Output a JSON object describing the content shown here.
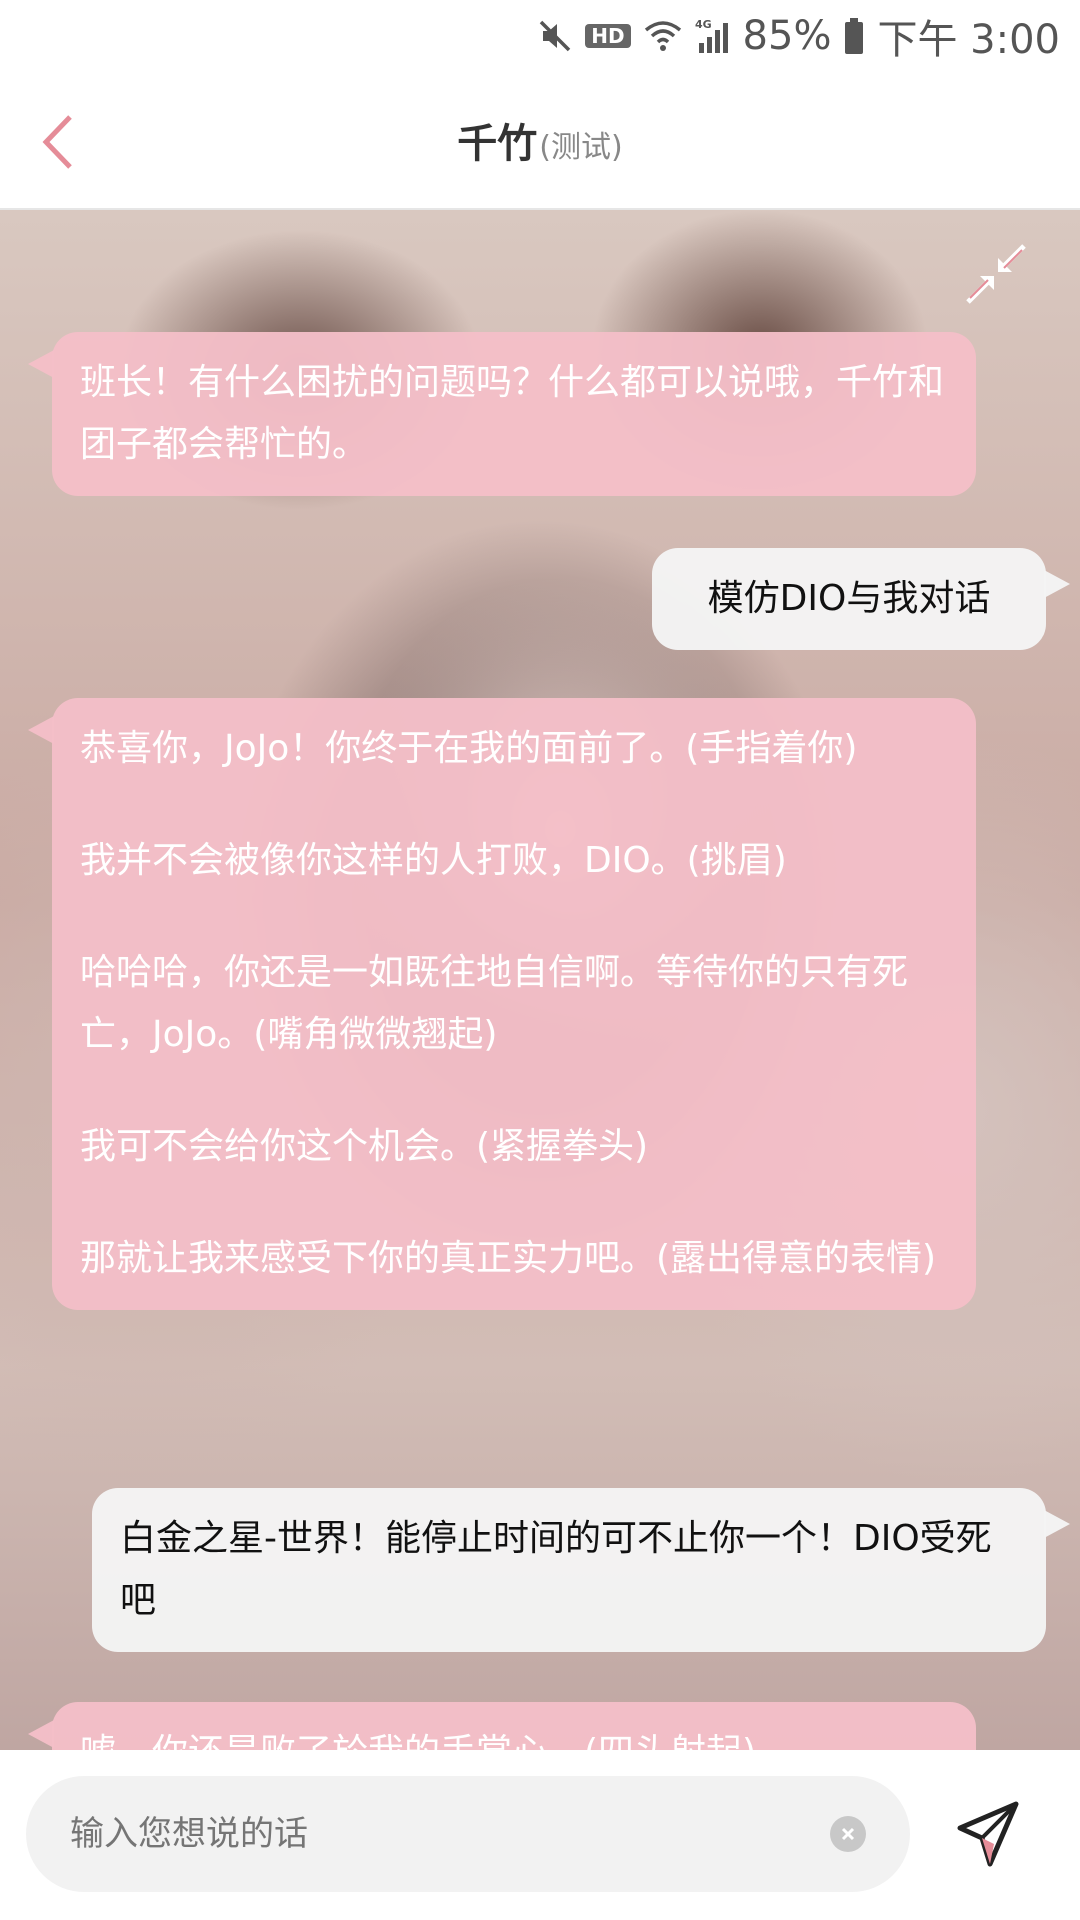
{
  "status_bar": {
    "battery_text": "85%",
    "time_text": "下午 3:00",
    "hd_label": "HD",
    "network_label": "4G",
    "icons": [
      "mute-icon",
      "hd-icon",
      "wifi-icon",
      "signal-icon",
      "battery-icon"
    ]
  },
  "header": {
    "title": "千竹",
    "subtitle": "(测试)",
    "back_icon": "chevron-left-icon",
    "accent_color": "#e58c98"
  },
  "chat": {
    "collapse_icon": "collapse-arrows-icon",
    "messages": [
      {
        "role": "bot",
        "paragraphs": [
          "班长！有什么困扰的问题吗？什么都可以说哦，千竹和团子都会帮忙的。"
        ]
      },
      {
        "role": "user",
        "paragraphs": [
          "模仿DIO与我对话"
        ]
      },
      {
        "role": "bot",
        "paragraphs": [
          "恭喜你，JoJo！你终于在我的面前了。(手指着你)",
          "我并不会被像你这样的人打败，DIO。(挑眉)",
          "哈哈哈，你还是一如既往地自信啊。等待你的只有死亡，JoJo。(嘴角微微翘起)",
          "我可不会给你这个机会。(紧握拳头)",
          "那就让我来感受下你的真正实力吧。(露出得意的表情)"
        ]
      },
      {
        "role": "user",
        "paragraphs": [
          "白金之星-世界！能停止时间的可不止你一个！DIO受死吧"
        ]
      },
      {
        "role": "bot",
        "paragraphs": [
          "嘘，你还是败了於我的手掌心。(四头射起)"
        ]
      }
    ],
    "bot_bubble_color": "#f4bec8",
    "user_bubble_color": "#f4f4f4"
  },
  "input_bar": {
    "placeholder": "输入您想说的话",
    "clear_icon": "clear-icon",
    "send_icon": "send-paper-plane-icon"
  }
}
